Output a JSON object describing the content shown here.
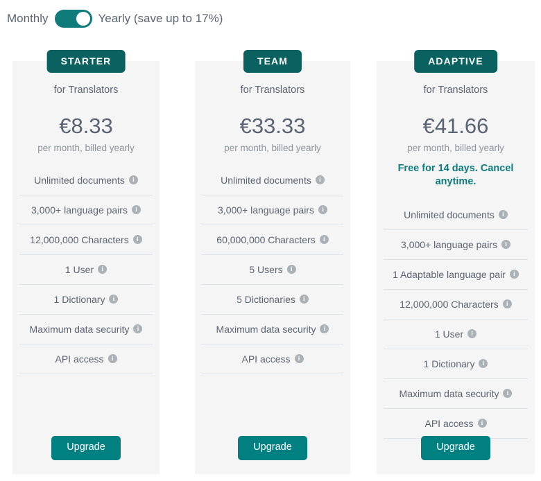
{
  "billing": {
    "monthly_label": "Monthly",
    "yearly_label": "Yearly (save up to 17%)",
    "selected": "yearly",
    "toggle_name": "billing-period-toggle"
  },
  "colors": {
    "badge_teal": "#0a6160",
    "button_teal": "#008080",
    "promo_teal": "#0e7c7c",
    "card_bg": "#f5f5f5",
    "text_slate": "#5a6472",
    "muted": "#8b949e",
    "divider": "#dde3e8",
    "info_icon": "#aab2b8"
  },
  "plans": [
    {
      "badge": "STARTER",
      "audience": "for Translators",
      "price": "€8.33",
      "billing_note": "per month, billed yearly",
      "promo": "",
      "features": [
        "Unlimited documents",
        "3,000+ language pairs",
        "12,000,000 Characters",
        "1 User",
        "1 Dictionary",
        "Maximum data security",
        "API access"
      ],
      "cta": "Upgrade"
    },
    {
      "badge": "TEAM",
      "audience": "for Translators",
      "price": "€33.33",
      "billing_note": "per month, billed yearly",
      "promo": "",
      "features": [
        "Unlimited documents",
        "3,000+ language pairs",
        "60,000,000 Characters",
        "5 Users",
        "5 Dictionaries",
        "Maximum data security",
        "API access"
      ],
      "cta": "Upgrade"
    },
    {
      "badge": "ADAPTIVE",
      "audience": "for Translators",
      "price": "€41.66",
      "billing_note": "per month, billed yearly",
      "promo": "Free for 14 days. Cancel anytime.",
      "features": [
        "Unlimited documents",
        "3,000+ language pairs",
        "1 Adaptable language pair",
        "12,000,000 Characters",
        "1 User",
        "1 Dictionary",
        "Maximum data security",
        "API access"
      ],
      "cta": "Upgrade"
    }
  ],
  "icons": {
    "info": "i"
  }
}
